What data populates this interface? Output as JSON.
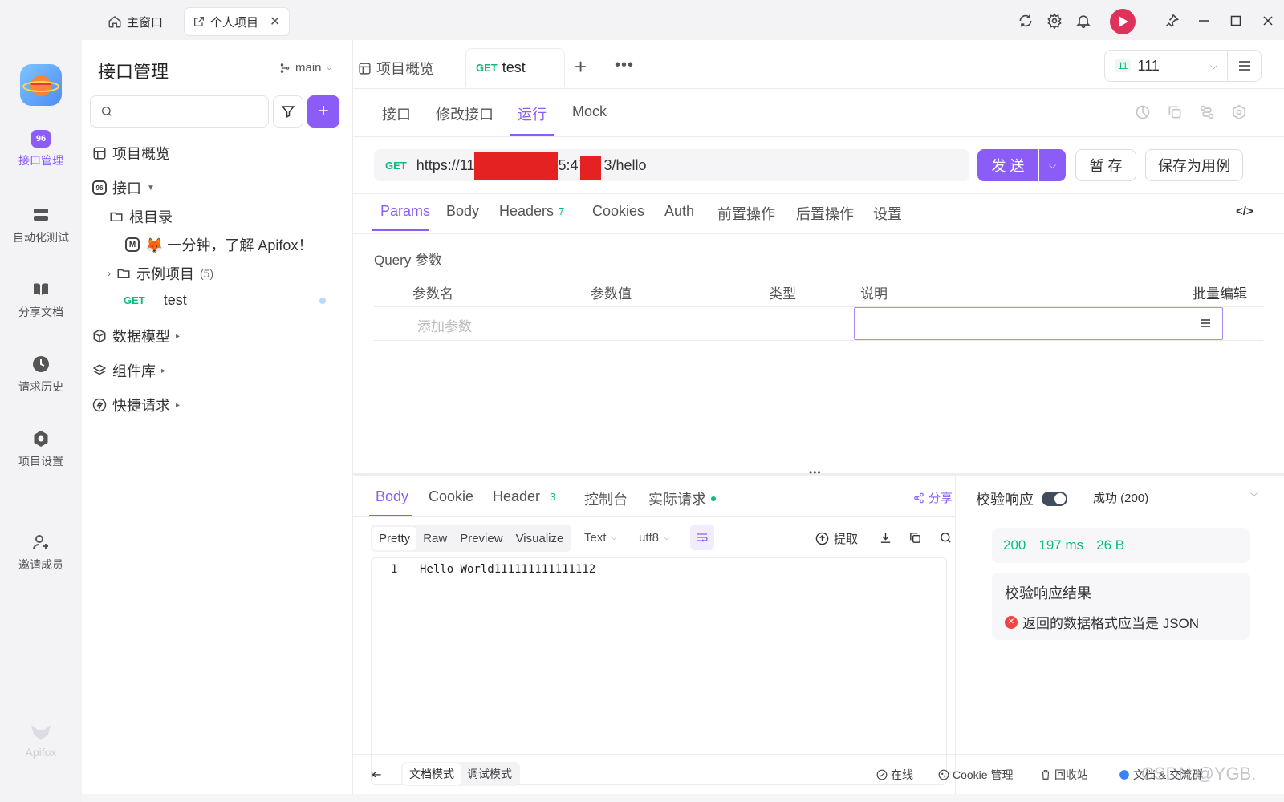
{
  "titlebar": {
    "tabs": [
      {
        "label": "主窗口",
        "icon": "home-icon"
      },
      {
        "label": "个人项目",
        "icon": "external-link-icon"
      }
    ],
    "icons": [
      "refresh-icon",
      "settings-icon",
      "bell-icon",
      "avatar",
      "pin-icon",
      "minimize-icon",
      "maximize-icon",
      "close-icon"
    ]
  },
  "rail": {
    "items": [
      {
        "label": "接口管理",
        "icon": "api-icon"
      },
      {
        "label": "自动化测试",
        "icon": "automation-icon"
      },
      {
        "label": "分享文档",
        "icon": "book-icon"
      },
      {
        "label": "请求历史",
        "icon": "clock-icon"
      },
      {
        "label": "项目设置",
        "icon": "gear-icon"
      },
      {
        "label": "邀请成员",
        "icon": "user-plus-icon"
      }
    ],
    "brand": "Apifox"
  },
  "sidebar": {
    "title": "接口管理",
    "branch": "main",
    "search_placeholder": "",
    "tree": {
      "overview": "项目概览",
      "api": "接口",
      "root": "根目录",
      "intro": "🦊 一分钟，了解 Apifox！",
      "examples": "示例项目",
      "examples_count": "(5)",
      "test_method": "GET",
      "test_name": "test",
      "models": "数据模型",
      "components": "组件库",
      "quick": "快捷请求"
    }
  },
  "main": {
    "doc_tabs": {
      "overview": "项目概览",
      "active_method": "GET",
      "active_name": "test"
    },
    "env": {
      "badge": "11",
      "name": "111"
    },
    "subtabs": [
      "接口",
      "修改接口",
      "运行",
      "Mock"
    ],
    "request": {
      "method": "GET",
      "url_prefix": "https://11",
      "url_mid": "5:47",
      "url_suffix": "3/hello",
      "send": "发 送",
      "save_temp": "暂 存",
      "save_case": "保存为用例"
    },
    "param_tabs": [
      "Params",
      "Body",
      "Headers",
      "Cookies",
      "Auth",
      "前置操作",
      "后置操作",
      "设置"
    ],
    "headers_count": "7",
    "query": {
      "title": "Query 参数",
      "cols": [
        "参数名",
        "参数值",
        "类型",
        "说明"
      ],
      "bulk": "批量编辑",
      "add_placeholder": "添加参数"
    },
    "response": {
      "tabs": [
        "Body",
        "Cookie",
        "Header",
        "控制台",
        "实际请求"
      ],
      "header_count": "3",
      "share": "分享",
      "formats": [
        "Pretty",
        "Raw",
        "Preview",
        "Visualize"
      ],
      "type": "Text",
      "encoding": "utf8",
      "extract": "提取",
      "line_no": "1",
      "body": "Hello World111111111111112"
    },
    "validate": {
      "label": "校验响应",
      "status": "成功 (200)",
      "code": "200",
      "time": "197 ms",
      "size": "26 B",
      "result_title": "校验响应结果",
      "result_msg": "返回的数据格式应当是 JSON"
    },
    "statusbar": {
      "doc_mode": "文档模式",
      "debug_mode": "调试模式",
      "online": "在线",
      "cookie": "Cookie 管理",
      "trash": "回收站",
      "community": "文档 & 交流群",
      "watermark": "CSDN @YGB."
    }
  }
}
